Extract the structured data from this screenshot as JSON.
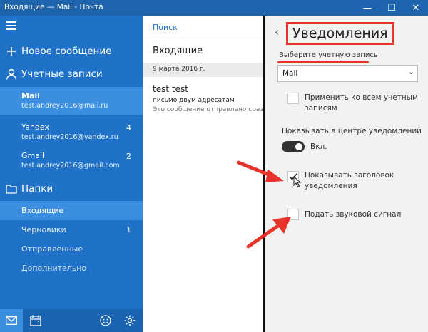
{
  "window": {
    "title": "Входящие — Mail - Почта",
    "minimize": "—",
    "maximize": "☐",
    "close": "✕"
  },
  "sidebar": {
    "new_message": "Новое сообщение",
    "accounts_label": "Учетные записи",
    "accounts": [
      {
        "name": "Mail",
        "email": "test.andrey2016@mail.ru",
        "count": ""
      },
      {
        "name": "Yandex",
        "email": "test.andrey2016@yandex.ru",
        "count": "4"
      },
      {
        "name": "Gmail",
        "email": "test.andrey2016@gmail.com",
        "count": "2"
      }
    ],
    "folders_label": "Папки",
    "folders": [
      {
        "name": "Входящие",
        "count": ""
      },
      {
        "name": "Черновики",
        "count": "1"
      },
      {
        "name": "Отправленные",
        "count": ""
      },
      {
        "name": "Дополнительно",
        "count": ""
      }
    ]
  },
  "message_list": {
    "search": "Поиск",
    "heading": "Входящие",
    "date_group": "9 марта 2016 г.",
    "messages": [
      {
        "from": "test test",
        "subject": "письмо двум адресатам",
        "preview": "Это сообщение отправлено сразу дв"
      }
    ]
  },
  "settings": {
    "title": "Уведомления",
    "select_account_label": "Выберите учетную запись",
    "selected_account": "Mail",
    "apply_all": "Применить ко всем учетным записям",
    "show_in_center": "Показывать в центре уведомлений",
    "toggle_state": "Вкл.",
    "show_header": "Показывать заголовок уведомления",
    "sound": "Подать звуковой сигнал"
  },
  "colors": {
    "sidebar": "#1f72c8",
    "selected": "#3c8ee0",
    "titlebar": "#1d64ad",
    "annotation": "#e8332a"
  }
}
